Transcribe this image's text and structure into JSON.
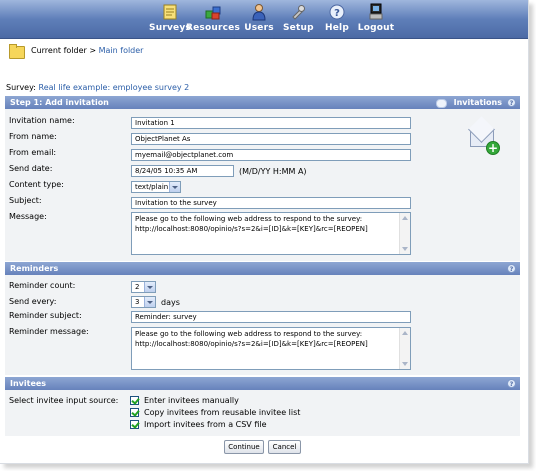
{
  "nav": {
    "items": [
      {
        "label": "Surveys",
        "icon": "surveys-icon"
      },
      {
        "label": "Resources",
        "icon": "resources-icon"
      },
      {
        "label": "Users",
        "icon": "users-icon"
      },
      {
        "label": "Setup",
        "icon": "setup-icon"
      },
      {
        "label": "Help",
        "icon": "help-icon"
      },
      {
        "label": "Logout",
        "icon": "logout-icon"
      }
    ]
  },
  "breadcrumb": {
    "prefix": "Current folder > ",
    "folder_link": "Main folder"
  },
  "survey": {
    "label": "Survey:",
    "name": "Real life example: employee survey 2"
  },
  "step1": {
    "title": "Step 1: Add invitation",
    "side_title": "Invitations",
    "fields": {
      "invitation_name": {
        "label": "Invitation name:",
        "value": "Invitation 1"
      },
      "from_name": {
        "label": "From name:",
        "value": "ObjectPlanet As"
      },
      "from_email": {
        "label": "From email:",
        "value": "myemail@objectplanet.com"
      },
      "send_date": {
        "label": "Send date:",
        "value": "8/24/05 10:35 AM",
        "hint": "(M/D/YY H:MM A)"
      },
      "content_type": {
        "label": "Content type:",
        "value": "text/plain"
      },
      "subject": {
        "label": "Subject:",
        "value": "Invitation to the survey"
      },
      "message": {
        "label": "Message:",
        "line1": "Please go to the following web address to respond to the survey:",
        "line2": "http://localhost:8080/opinio/s?s=2&i=[ID]&k=[KEY]&rc=[REOPEN]"
      }
    }
  },
  "reminders": {
    "title": "Reminders",
    "count": {
      "label": "Reminder count:",
      "value": "2"
    },
    "every": {
      "label": "Send every:",
      "value": "3",
      "unit": "days"
    },
    "subject": {
      "label": "Reminder subject:",
      "value": "Reminder: survey"
    },
    "message": {
      "label": "Reminder message:",
      "line1": "Please go to the following web address to respond to the survey:",
      "line2": "http://localhost:8080/opinio/s?s=2&i=[ID]&k=[KEY]&rc=[REOPEN]"
    }
  },
  "invitees": {
    "title": "Invitees",
    "source_label": "Select invitee input source:",
    "options": [
      "Enter invitees manually",
      "Copy invitees from reusable invitee list",
      "Import invitees from a CSV file"
    ]
  },
  "buttons": {
    "continue": "Continue",
    "cancel": "Cancel"
  },
  "colors": {
    "nav_bg": "#5f7fb9",
    "section_header": "#6682bb",
    "link": "#2b5ea8",
    "section_body": "#f1f3f5"
  }
}
